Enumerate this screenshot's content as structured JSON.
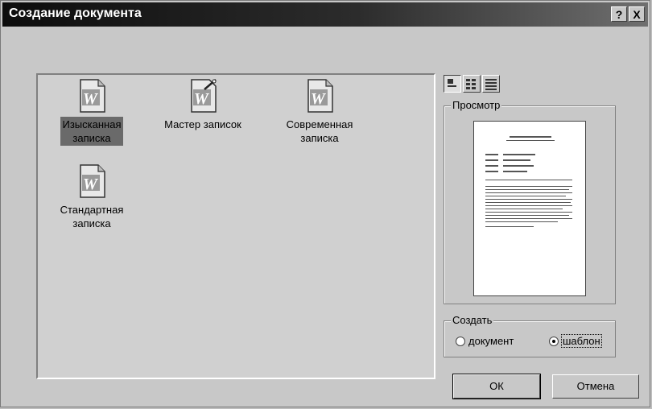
{
  "dialog": {
    "title": "Создание документа",
    "help_label": "?",
    "close_label": "X"
  },
  "templates": [
    {
      "label": "Изысканная записка",
      "line1": "Изысканная",
      "line2": "записка",
      "icon": "word-template-icon",
      "selected": true
    },
    {
      "label": "Мастер записок",
      "line1": "Мастер записок",
      "line2": "",
      "icon": "wizard-template-icon",
      "selected": false
    },
    {
      "label": "Современная записка",
      "line1": "Современная",
      "line2": "записка",
      "icon": "word-template-icon",
      "selected": false
    },
    {
      "label": "Стандартная записка",
      "line1": "Стандартная",
      "line2": "записка",
      "icon": "word-template-icon",
      "selected": false
    }
  ],
  "view_buttons": [
    "large-icons-icon",
    "list-view-icon",
    "details-view-icon"
  ],
  "preview": {
    "label": "Просмотр"
  },
  "create": {
    "label": "Создать",
    "option_document": "документ",
    "option_template": "шаблон",
    "selected": "шаблон"
  },
  "buttons": {
    "ok": "ОК",
    "cancel": "Отмена"
  }
}
